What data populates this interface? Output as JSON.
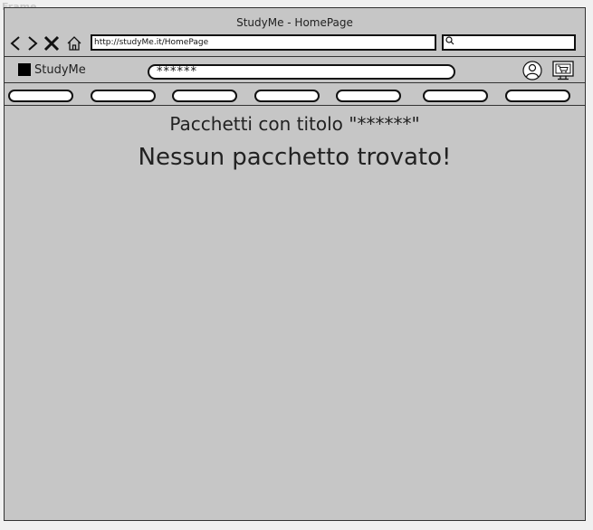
{
  "frame": {
    "label": "Frame"
  },
  "window": {
    "title": "StudyMe - HomePage"
  },
  "browser": {
    "url": "http://studyMe.it/HomePage",
    "search_value": ""
  },
  "app": {
    "logo_text": "StudyMe",
    "search_value": "******",
    "tab_count": 7
  },
  "content": {
    "subtitle": "Pacchetti con titolo \"******\"",
    "message": "Nessun pacchetto trovato!"
  },
  "icons": {
    "back": "chevron-left-icon",
    "forward": "chevron-right-icon",
    "close": "close-icon",
    "home": "home-icon",
    "search": "search-icon",
    "user": "user-icon",
    "cart": "cart-icon"
  },
  "colors": {
    "window_bg": "#c6c6c6",
    "page_bg": "#f0f0f0",
    "stroke": "#111111"
  }
}
